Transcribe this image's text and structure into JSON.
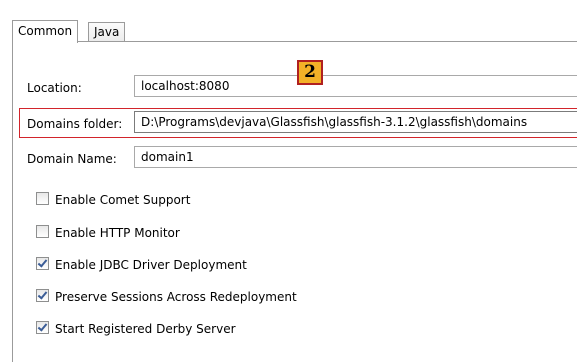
{
  "tabs": [
    {
      "label": "Common",
      "active": true
    },
    {
      "label": "Java",
      "active": false
    }
  ],
  "fields": {
    "location": {
      "label": "Location:",
      "value": "localhost:8080"
    },
    "domains_folder": {
      "label": "Domains folder:",
      "value": "D:\\Programs\\devjava\\Glassfish\\glassfish-3.1.2\\glassfish\\domains"
    },
    "domain_name": {
      "label": "Domain Name:",
      "value": "domain1"
    }
  },
  "annotation": {
    "badge_text": "2",
    "highlight_color": "#d2242b",
    "badge_color": "#f3b127"
  },
  "options": [
    {
      "label": "Enable Comet Support",
      "checked": false
    },
    {
      "label": "Enable HTTP Monitor",
      "checked": false
    },
    {
      "label": "Enable JDBC Driver Deployment",
      "checked": true
    },
    {
      "label": "Preserve Sessions Across Redeployment",
      "checked": true
    },
    {
      "label": "Start Registered Derby Server",
      "checked": true
    }
  ]
}
